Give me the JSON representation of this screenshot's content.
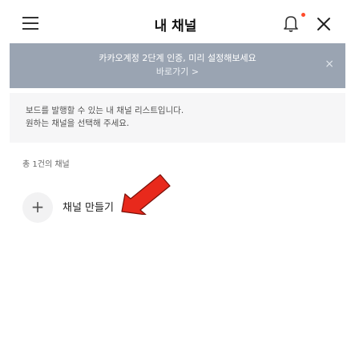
{
  "header": {
    "title": "내 채널"
  },
  "banner": {
    "message": "카카오계정 2단계 인증, 미리 설정해보세요",
    "link_label": "바로가기 >",
    "close_label": "×"
  },
  "info": {
    "line1": "보드를 발행할 수 있는 내 채널 리스트입니다.",
    "line2": "원하는 채널을 선택해 주세요."
  },
  "channel_count": "총 1건의 채널",
  "create_button": {
    "icon": "+",
    "label": "채널 만들기"
  },
  "colors": {
    "banner_bg": "#9aa4b2",
    "arrow": "#e8291c",
    "notification_dot": "#ff4b2b"
  }
}
